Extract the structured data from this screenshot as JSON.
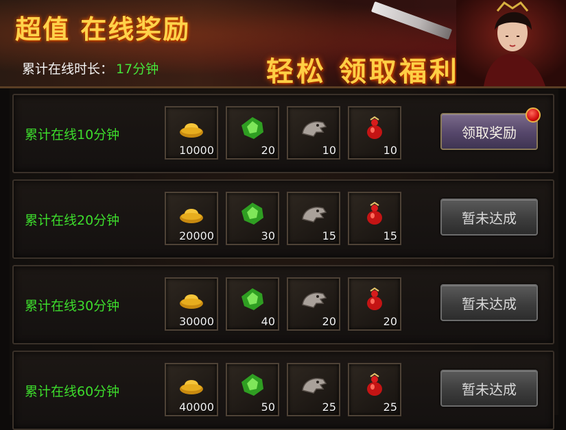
{
  "banner": {
    "title": "超值  在线奖励",
    "slogan": "轻松 领取福利",
    "online_label": "累计在线时长：",
    "online_value": "17分钟"
  },
  "rows": [
    {
      "label": "累计在线10分钟",
      "items": [
        {
          "icon": "gold-ingot-icon",
          "count": "10000"
        },
        {
          "icon": "green-gem-icon",
          "count": "20"
        },
        {
          "icon": "dragon-skull-icon",
          "count": "10"
        },
        {
          "icon": "red-gourd-icon",
          "count": "10"
        }
      ],
      "button": "领取奖励",
      "button_state": "active"
    },
    {
      "label": "累计在线20分钟",
      "items": [
        {
          "icon": "gold-ingot-icon",
          "count": "20000"
        },
        {
          "icon": "green-gem-icon",
          "count": "30"
        },
        {
          "icon": "dragon-skull-icon",
          "count": "15"
        },
        {
          "icon": "red-gourd-icon",
          "count": "15"
        }
      ],
      "button": "暂未达成",
      "button_state": "disabled"
    },
    {
      "label": "累计在线30分钟",
      "items": [
        {
          "icon": "gold-ingot-icon",
          "count": "30000"
        },
        {
          "icon": "green-gem-icon",
          "count": "40"
        },
        {
          "icon": "dragon-skull-icon",
          "count": "20"
        },
        {
          "icon": "red-gourd-icon",
          "count": "20"
        }
      ],
      "button": "暂未达成",
      "button_state": "disabled"
    },
    {
      "label": "累计在线60分钟",
      "items": [
        {
          "icon": "gold-ingot-icon",
          "count": "40000"
        },
        {
          "icon": "green-gem-icon",
          "count": "50"
        },
        {
          "icon": "dragon-skull-icon",
          "count": "25"
        },
        {
          "icon": "red-gourd-icon",
          "count": "25"
        }
      ],
      "button": "暂未达成",
      "button_state": "disabled"
    }
  ],
  "colors": {
    "label_green": "#3ddc2c",
    "online_value_green": "#45e53a",
    "title_gold": "#ffd24a"
  }
}
